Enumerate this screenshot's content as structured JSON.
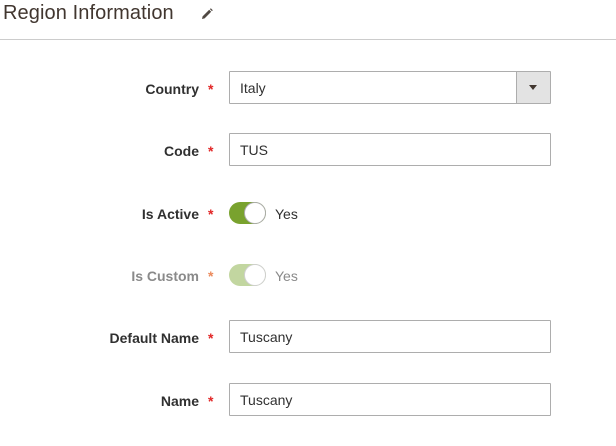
{
  "section": {
    "title": "Region Information"
  },
  "fields": {
    "country": {
      "label": "Country",
      "required_mark": "*",
      "selected": "Italy"
    },
    "code": {
      "label": "Code",
      "required_mark": "*",
      "value": "TUS"
    },
    "is_active": {
      "label": "Is Active",
      "required_mark": "*",
      "state_text": "Yes"
    },
    "is_custom": {
      "label": "Is Custom",
      "required_mark": "*",
      "state_text": "Yes"
    },
    "default_name": {
      "label": "Default Name",
      "required_mark": "*",
      "value": "Tuscany"
    },
    "name": {
      "label": "Name",
      "required_mark": "*",
      "value": "Tuscany"
    }
  },
  "colors": {
    "required": "#e22626",
    "toggle_on": "#79a22e",
    "toggle_disabled": "#c2d6a0",
    "border": "#adadad"
  },
  "icons": {
    "edit": "pencil-icon",
    "dropdown": "chevron-down-icon"
  }
}
